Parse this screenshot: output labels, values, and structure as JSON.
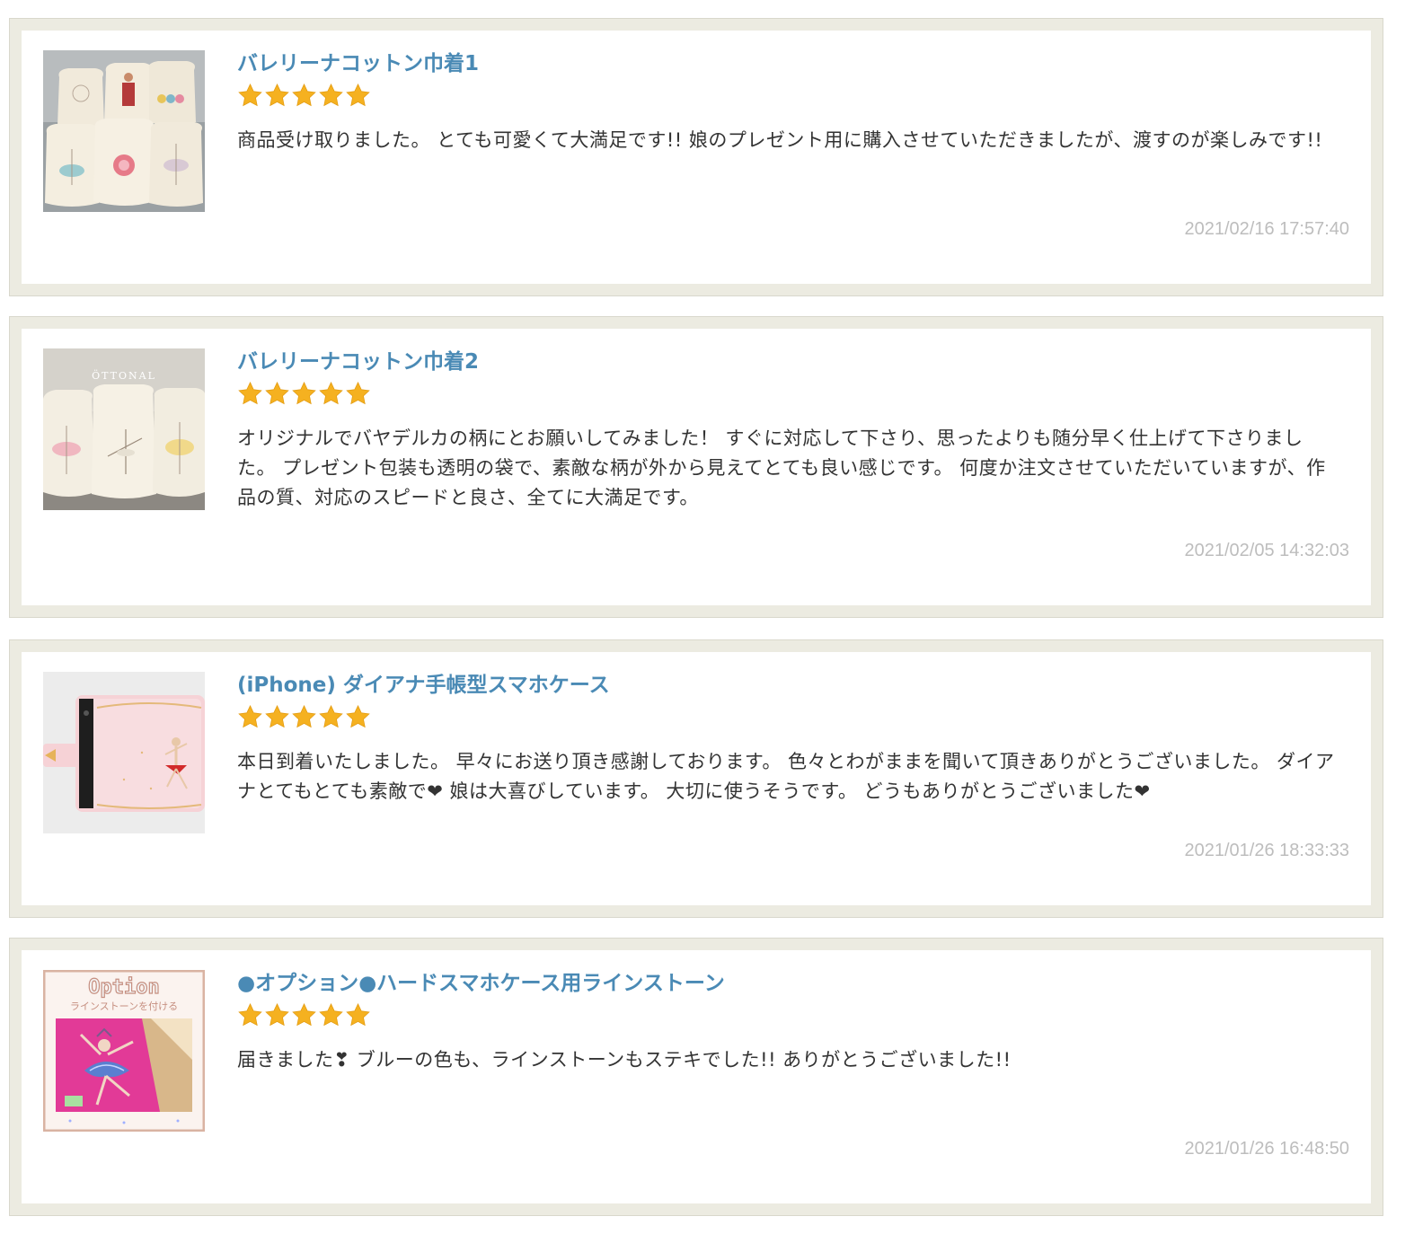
{
  "colors": {
    "card_border": "#ecebe1",
    "title": "#4a8ab5",
    "body_text": "#333333",
    "date": "#bdbdbd",
    "star": "#f5b120"
  },
  "reviews": [
    {
      "thumbnail": "drawstring-bags-photo",
      "title": "バレリーナコットン巾着1",
      "rating": 5,
      "comment": "商品受け取りました。 とても可愛くて大満足です!! 娘のプレゼント用に購入させていただきましたが、渡すのが楽しみです!!",
      "date": "2021/02/16 17:57:40"
    },
    {
      "thumbnail": "drawstring-bags-photo",
      "title": "バレリーナコットン巾着2",
      "rating": 5,
      "comment": "オリジナルでバヤデルカの柄にとお願いしてみました！ すぐに対応して下さり、思ったよりも随分早く仕上げて下さりました。 プレゼント包装も透明の袋で、素敵な柄が外から見えてとても良い感じです。 何度か注文させていただいていますが、作品の質、対応のスピードと良さ、全てに大満足です。",
      "date": "2021/02/05 14:32:03"
    },
    {
      "thumbnail": "phone-case-photo",
      "title": "(iPhone) ダイアナ手帳型スマホケース",
      "rating": 5,
      "comment": "本日到着いたしました。 早々にお送り頂き感謝しております。 色々とわがままを聞いて頂きありがとうございました。 ダイアナとてもとても素敵で❤ 娘は大喜びしています。 大切に使うそうです。 どうもありがとうございました❤",
      "date": "2021/01/26 18:33:33"
    },
    {
      "thumbnail": "rhinestone-option-photo",
      "thumb_text_1": "Option",
      "thumb_text_2": "ラインストーンを付ける",
      "title": "●オプション●ハードスマホケース用ラインストーン",
      "rating": 5,
      "comment": "届きました❣ ブルーの色も、ラインストーンもステキでした!! ありがとうございました!!",
      "date": "2021/01/26 16:48:50"
    }
  ]
}
